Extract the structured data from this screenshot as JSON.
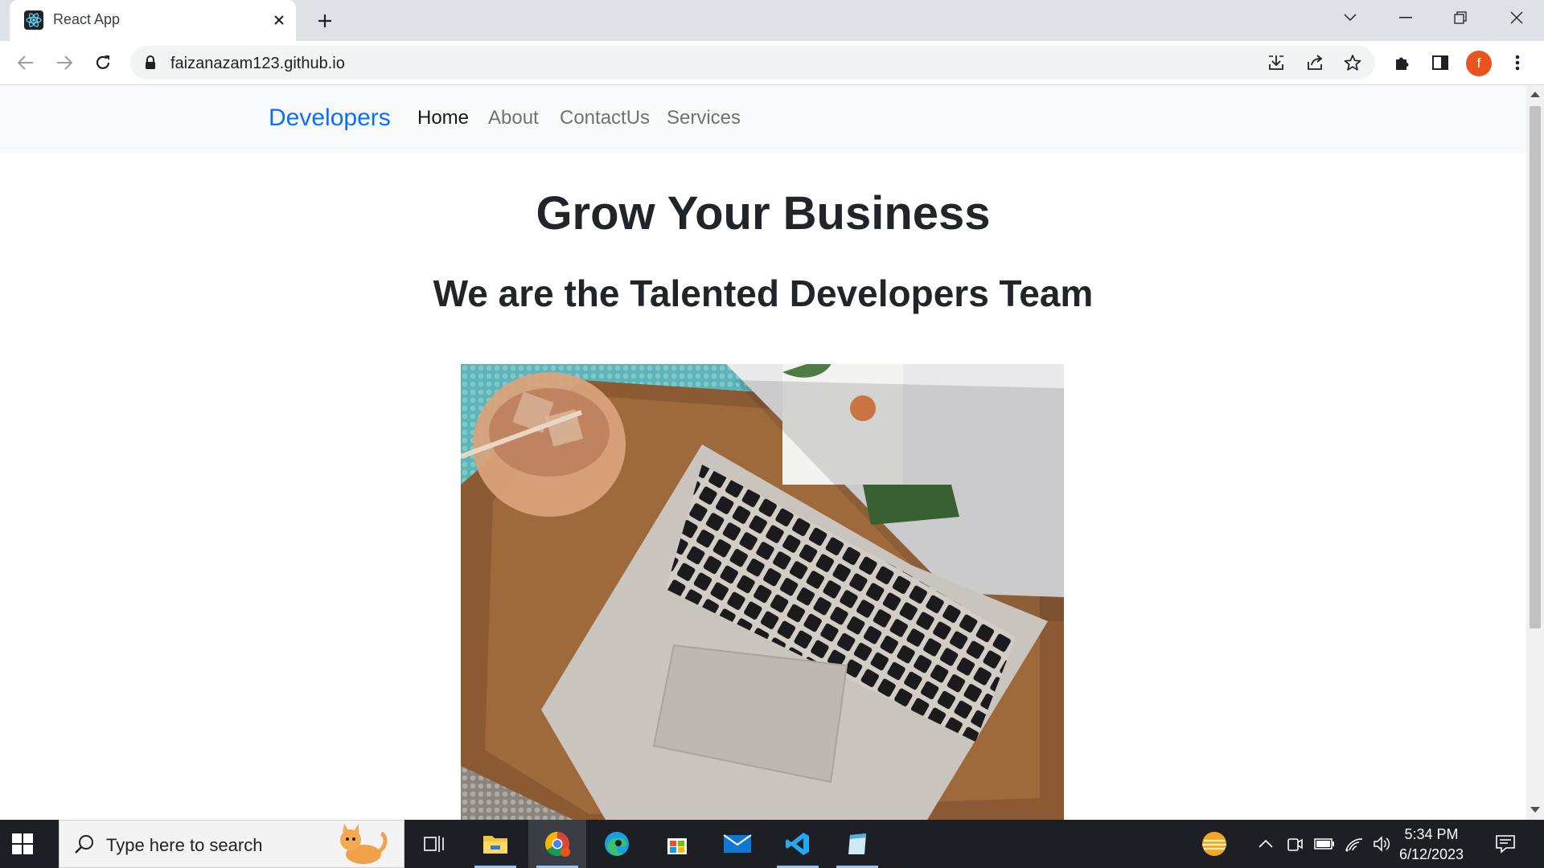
{
  "browser": {
    "tab_title": "React App",
    "url": "faizanazam123.github.io",
    "profile_initial": "f",
    "icons": {
      "favicon": "react-icon",
      "tab_close": "close-icon",
      "new_tab": "plus-icon",
      "tab_search": "chevron-down-icon",
      "minimize": "minimize-icon",
      "restore": "restore-icon",
      "close_window": "close-icon",
      "back": "arrow-left-icon",
      "forward": "arrow-right-icon",
      "reload": "reload-icon",
      "lock": "lock-icon",
      "install": "download-icon",
      "share": "share-icon",
      "bookmark": "star-icon",
      "extensions": "puzzle-icon",
      "side_panel": "side-panel-icon",
      "menu": "kebab-menu-icon"
    }
  },
  "site": {
    "brand": "Developers",
    "nav": [
      "Home",
      "About",
      "ContactUs",
      "Services"
    ],
    "active_nav": "Home",
    "hero_title": "Grow Your Business",
    "hero_subtitle": "We are the Talented Developers Team",
    "hero_image": "laptop-coffee-photo",
    "brand_color": "#0d6efd"
  },
  "taskbar": {
    "search_placeholder": "Type here to search",
    "time": "5:34 PM",
    "date": "6/12/2023",
    "apps": [
      "task-view-icon",
      "file-explorer-icon",
      "chrome-icon",
      "edge-icon",
      "store-icon",
      "mail-icon",
      "vscode-icon",
      "notepad-icon"
    ],
    "tray": [
      "weather-icon",
      "chevron-up-icon",
      "meet-icon",
      "battery-icon",
      "wifi-icon",
      "volume-icon",
      "notification-icon"
    ]
  }
}
